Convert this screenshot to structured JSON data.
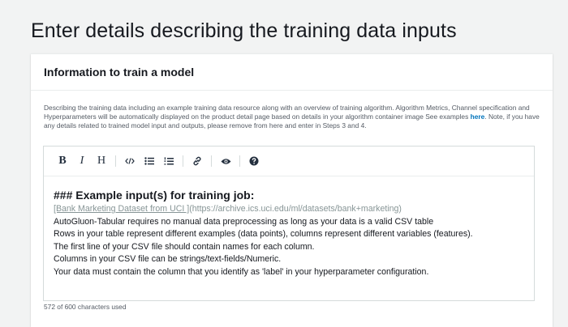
{
  "page": {
    "title": "Enter details describing the training data inputs"
  },
  "panel": {
    "title": "Information to train a model",
    "description_before_link": "Describing the training data including an example training data resource along with an overview of training algorithm. Algorithm Metrics, Channel specification and Hyperparameters will be automatically displayed on the product detail page based on details in your algorithm container image See examples ",
    "description_link": "here",
    "description_after_link": ". Note, if you have any details related to trained model input and outputs, please remove from here and enter in Steps 3 and 4.",
    "char_count": "572 of 600 characters used"
  },
  "toolbar": {
    "bold": "B",
    "italic": "I",
    "heading": "H",
    "code_icon": "code-icon",
    "bullet_list_icon": "bullet-list-icon",
    "numbered_list_icon": "numbered-list-icon",
    "link_icon": "link-icon",
    "preview_icon": "eye-icon",
    "help_icon": "help-icon"
  },
  "editor": {
    "heading": "### Example input(s) for training job:",
    "link_text": "[Bank Marketing Dataset from UCI ]",
    "link_url": "(https://archive.ics.uci.edu/ml/datasets/bank+marketing)",
    "lines": [
      "AutoGluon-Tabular requires no manual data preprocessing as long as your data is a valid CSV table",
      "Rows in your table represent different examples (data points), columns represent different variables (features).",
      "The first line of your CSV file should contain names for each column.",
      "Columns in your CSV file can be strings/text-fields/Numeric.",
      "Your data must contain the column that you identify as 'label' in your hyperparameter configuration."
    ]
  },
  "colors": {
    "background": "#f2f3f3",
    "link": "#0073bb",
    "muted_link": "#879596",
    "text": "#16191f"
  }
}
